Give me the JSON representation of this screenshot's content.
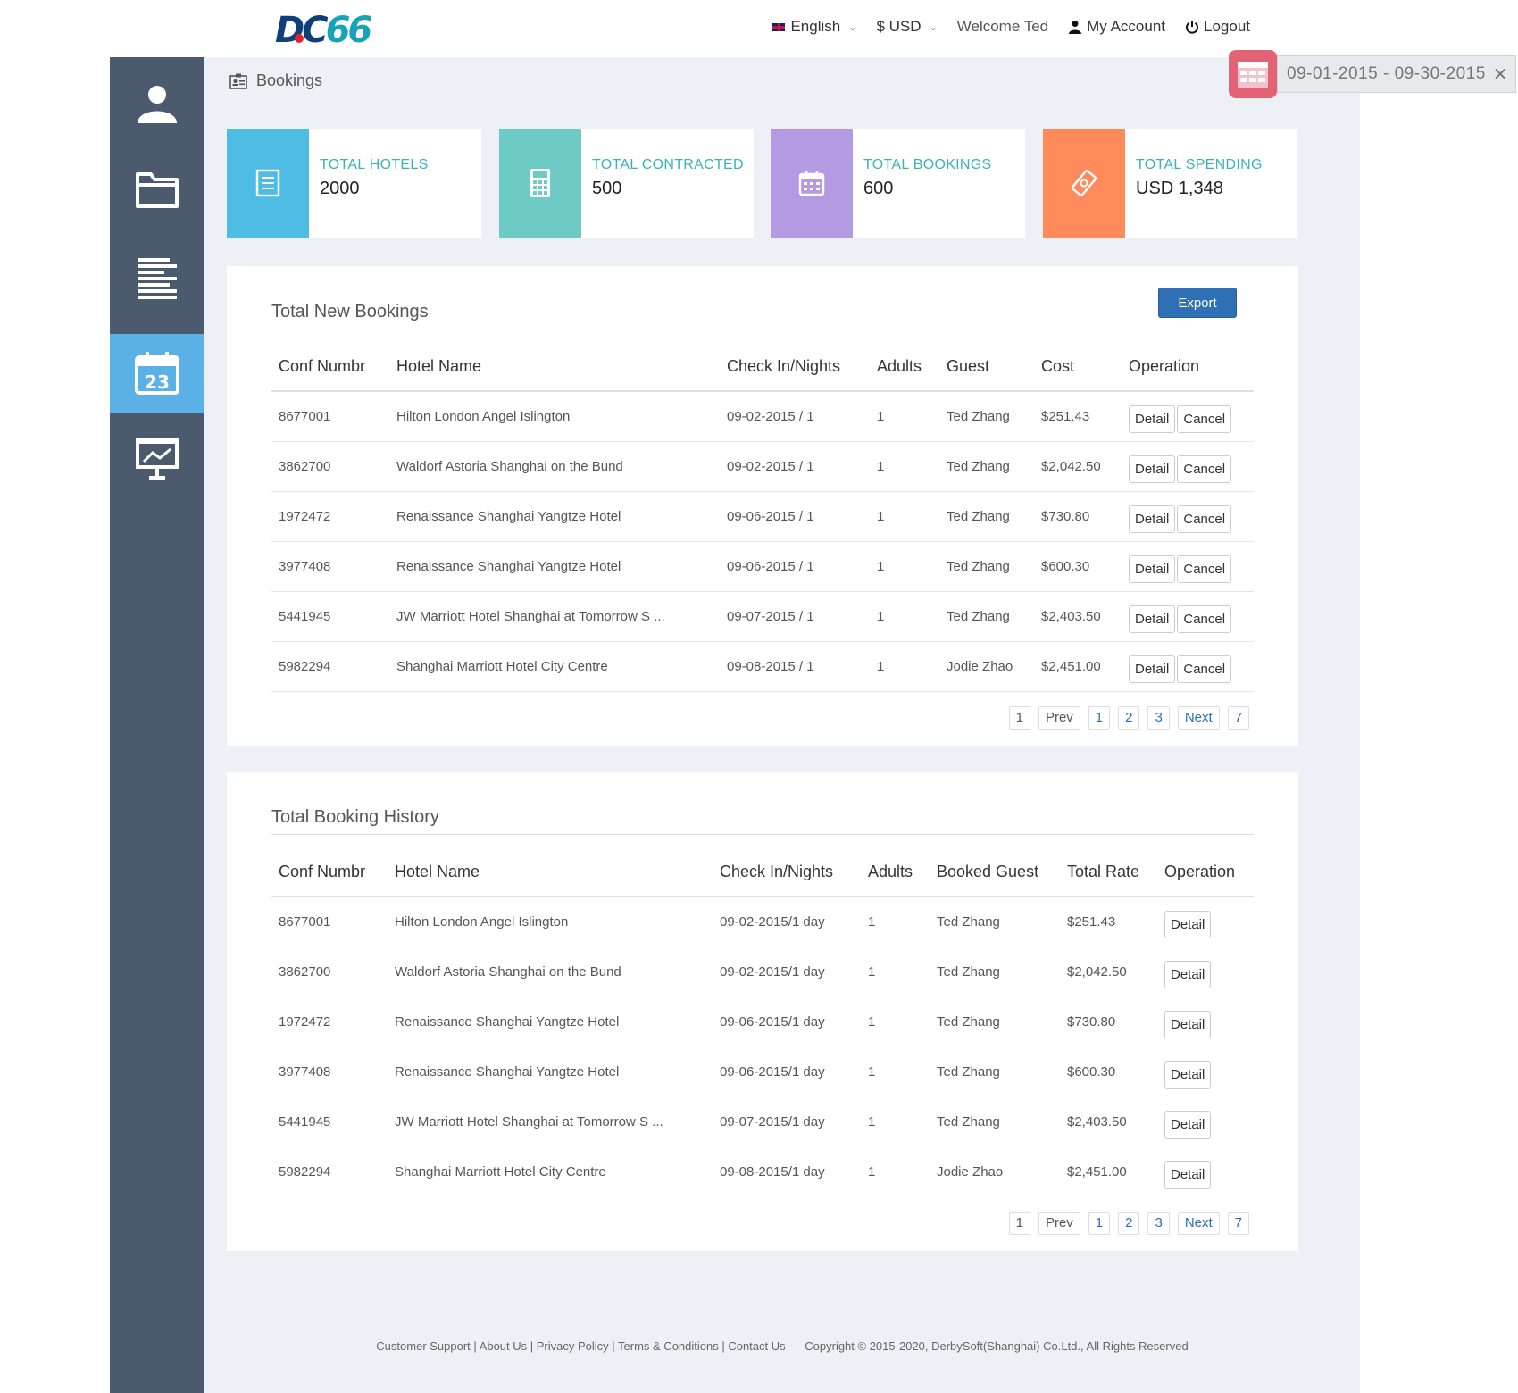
{
  "header": {
    "logo_a": "DC",
    "logo_b": "66",
    "language": "English",
    "currency": "$ USD",
    "welcome": "Welcome Ted",
    "account": "My Account",
    "logout": "Logout"
  },
  "breadcrumb": "Bookings",
  "date_range": "09-01-2015 - 09-30-2015",
  "stats": [
    {
      "label": "TOTAL HOTELS",
      "value": "2000",
      "color": "#4fbde3"
    },
    {
      "label": "TOTAL CONTRACTED",
      "value": "500",
      "color": "#6ecac4"
    },
    {
      "label": "TOTAL BOOKINGS",
      "value": "600",
      "color": "#b49ae3"
    },
    {
      "label": "TOTAL SPENDING",
      "value": "USD 1,348",
      "color": "#ff8a5c"
    }
  ],
  "new_bookings": {
    "title": "Total New Bookings",
    "export": "Export",
    "headers": [
      "Conf Numbr",
      "Hotel Name",
      "Check In/Nights",
      "Adults",
      "Guest",
      "Cost",
      "Operation"
    ],
    "rows": [
      [
        "8677001",
        "Hilton London Angel Islington",
        "09-02-2015 / 1",
        "1",
        "Ted Zhang",
        "$251.43"
      ],
      [
        "3862700",
        "Waldorf Astoria Shanghai on the Bund",
        "09-02-2015 / 1",
        "1",
        "Ted Zhang",
        "$2,042.50"
      ],
      [
        "1972472",
        "Renaissance Shanghai Yangtze Hotel",
        "09-06-2015 / 1",
        "1",
        "Ted Zhang",
        "$730.80"
      ],
      [
        "3977408",
        "Renaissance Shanghai Yangtze Hotel",
        "09-06-2015 / 1",
        "1",
        "Ted Zhang",
        "$600.30"
      ],
      [
        "5441945",
        "JW Marriott Hotel Shanghai at Tomorrow S ...",
        "09-07-2015 / 1",
        "1",
        "Ted Zhang",
        "$2,403.50"
      ],
      [
        "5982294",
        "Shanghai Marriott Hotel City Centre",
        "09-08-2015 / 1",
        "1",
        "Jodie Zhao",
        "$2,451.00"
      ]
    ],
    "detail": "Detail",
    "cancel": "Cancel"
  },
  "history": {
    "title": "Total Booking History",
    "headers": [
      "Conf Numbr",
      "Hotel Name",
      "Check In/Nights",
      "Adults",
      "Booked Guest",
      "Total Rate",
      "Operation"
    ],
    "rows": [
      [
        "8677001",
        "Hilton London Angel Islington",
        "09-02-2015/1 day",
        "1",
        "Ted Zhang",
        "$251.43"
      ],
      [
        "3862700",
        "Waldorf Astoria Shanghai on the Bund",
        "09-02-2015/1 day",
        "1",
        "Ted Zhang",
        "$2,042.50"
      ],
      [
        "1972472",
        "Renaissance Shanghai Yangtze Hotel",
        "09-06-2015/1 day",
        "1",
        "Ted Zhang",
        "$730.80"
      ],
      [
        "3977408",
        "Renaissance Shanghai Yangtze Hotel",
        "09-06-2015/1 day",
        "1",
        "Ted Zhang",
        "$600.30"
      ],
      [
        "5441945",
        "JW Marriott Hotel Shanghai at Tomorrow S ...",
        "09-07-2015/1 day",
        "1",
        "Ted Zhang",
        "$2,403.50"
      ],
      [
        "5982294",
        "Shanghai Marriott Hotel City Centre",
        "09-08-2015/1 day",
        "1",
        "Jodie Zhao",
        "$2,451.00"
      ]
    ],
    "detail": "Detail"
  },
  "pager": [
    "1",
    "Prev",
    "1",
    "2",
    "3",
    "Next",
    "7"
  ],
  "footer": {
    "links": "Customer Support | About Us | Privacy Policy | Terms & Conditions | Contact Us",
    "copyright": "Copyright © 2015-2020, DerbySoft(Shanghai) Co.Ltd., All Rights Reserved"
  },
  "sidebar_icons": [
    "user-icon",
    "folder-icon",
    "list-icon",
    "calendar-icon",
    "presentation-icon"
  ]
}
